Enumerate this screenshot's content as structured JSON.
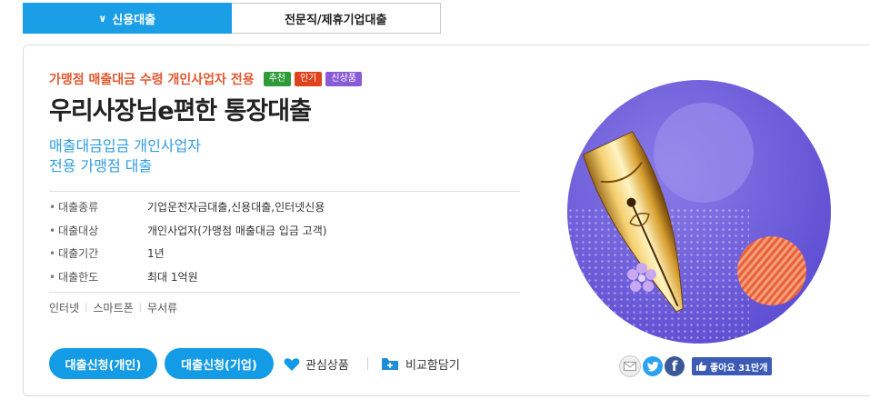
{
  "tabs": [
    {
      "label": "신용대출",
      "active": true
    },
    {
      "label": "전문직/제휴기업대출",
      "active": false
    }
  ],
  "product": {
    "eyebrow": "가맹점 매출대금 수령 개인사업자 전용",
    "badges": [
      {
        "label": "추천",
        "color": "#2e9a3a"
      },
      {
        "label": "인기",
        "color": "#e0421c"
      },
      {
        "label": "신상품",
        "color": "#8a5bd6"
      }
    ],
    "title": "우리사장님e편한 통장대출",
    "subtitle_line1": "매출대금입금 개인사업자",
    "subtitle_line2": "전용 가맹점 대출",
    "info": [
      {
        "label": "대출종류",
        "value": "기업운전자금대출,신용대출,인터넷신용"
      },
      {
        "label": "대출대상",
        "value": "개인사업자(가맹점 매출대금 입금 고객)"
      },
      {
        "label": "대출기간",
        "value": "1년"
      },
      {
        "label": "대출한도",
        "value": "최대 1억원"
      }
    ],
    "channels": [
      "인터넷",
      "스마트폰",
      "무서류"
    ]
  },
  "actions": {
    "apply_personal": "대출신청(개인)",
    "apply_business": "대출신청(기업)",
    "favorite": "관심상품",
    "compare": "비교함담기"
  },
  "social": {
    "like_label": "좋아요 31만개",
    "icons": [
      "email-share-icon",
      "twitter-icon",
      "facebook-icon"
    ]
  },
  "colors": {
    "accent_blue": "#149be5",
    "eyebrow_red": "#e4572e",
    "illustration_purple": "#6a5ad8"
  }
}
